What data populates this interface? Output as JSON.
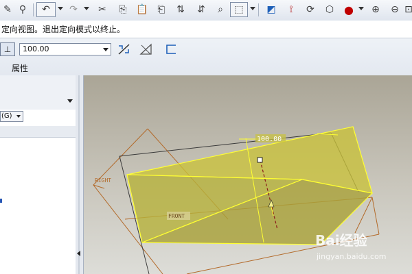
{
  "toolbar": {
    "icons": [
      "sketch-icon",
      "datum-icon",
      "undo-icon",
      "redo-icon",
      "cut-icon",
      "copy-icon",
      "paste-icon",
      "paste-special-icon",
      "regenerate-icon",
      "find-icon",
      "search-icon",
      "select-box-icon",
      "sketch-view-icon",
      "node-icon",
      "spin-icon",
      "orient-icon",
      "appearance-icon",
      "zoom-in-icon",
      "zoom-out-icon"
    ]
  },
  "message": {
    "text": "定向视图。退出定向模式以终止。"
  },
  "dashboard": {
    "depth_value": "100.00",
    "properties_label": "属性"
  },
  "left_panel": {
    "filter_label": "(G)"
  },
  "viewport": {
    "dimension_value": "100.00",
    "datum_right": "RIGHT",
    "datum_front": "FRONT"
  },
  "watermark": {
    "brand": "Bai经验",
    "url": "jingyan.baidu.com"
  },
  "colors": {
    "solid_fill": "#c9c23a",
    "solid_edge": "#ffff33",
    "datum_line": "#b36a2a",
    "viewport_top": "#aaa596",
    "viewport_bottom": "#ddddd8"
  }
}
